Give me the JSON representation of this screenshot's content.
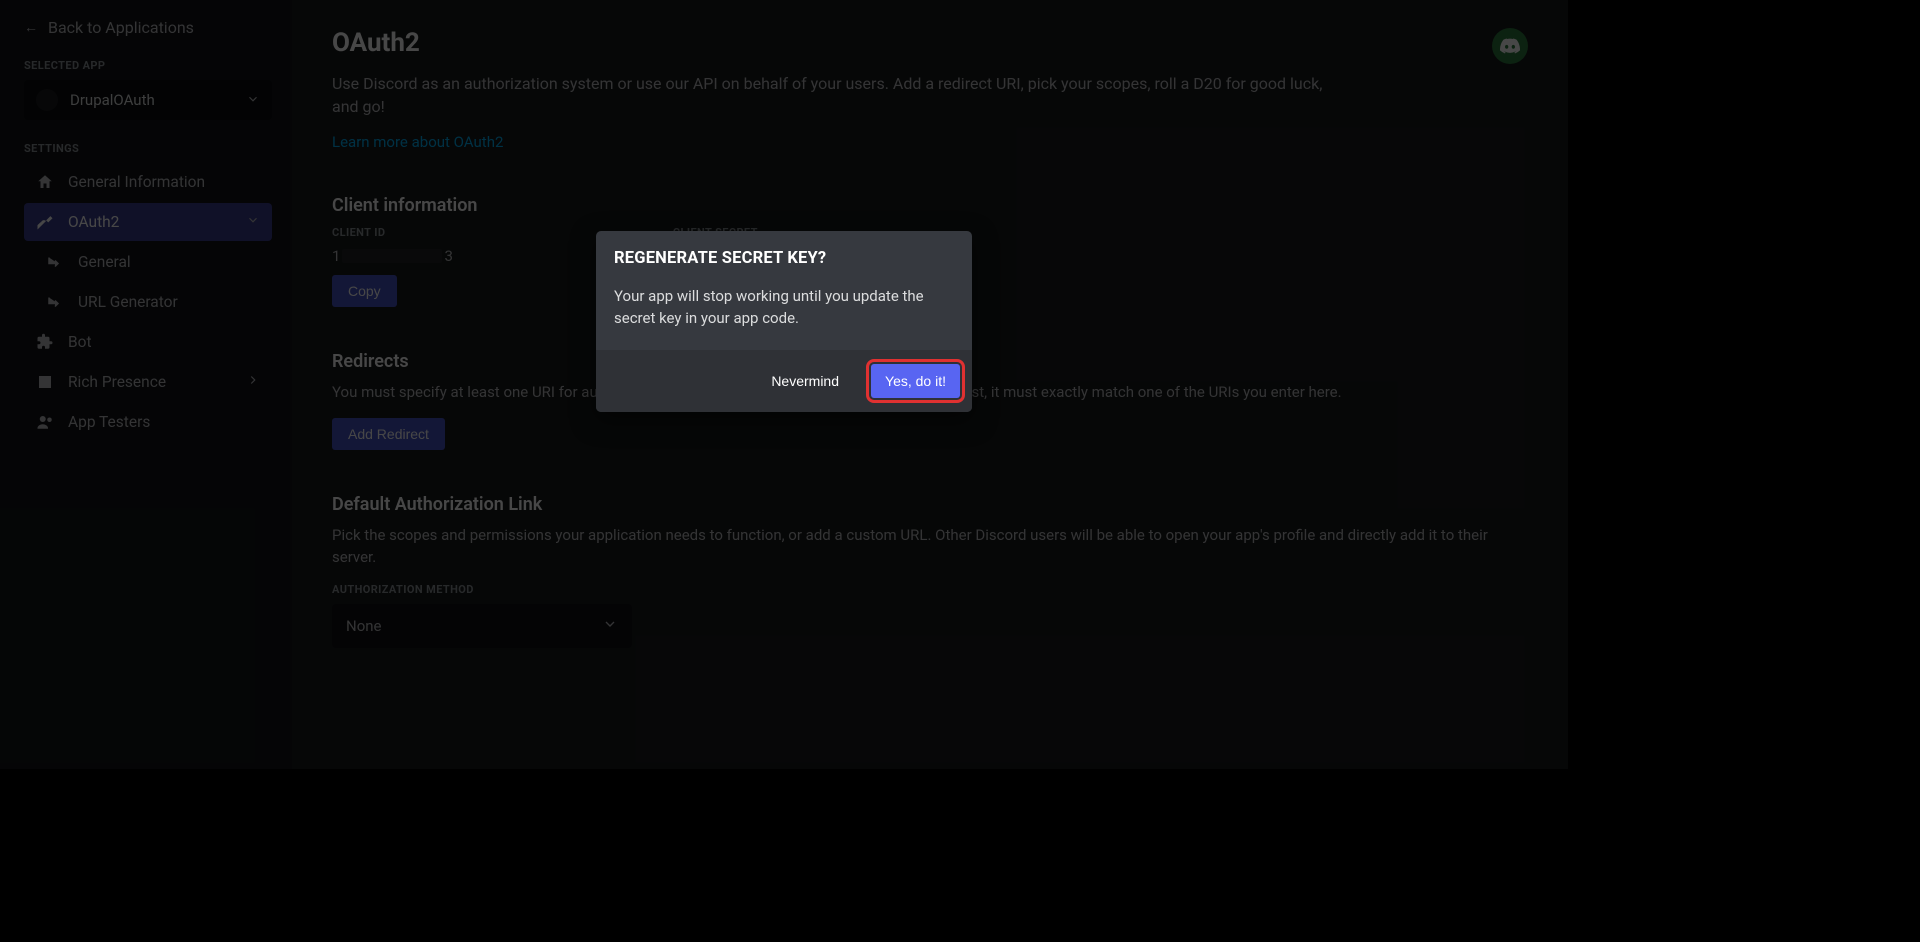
{
  "sidebar": {
    "back_label": "Back to Applications",
    "selected_app_label": "SELECTED APP",
    "app_name": "DrupalOAuth",
    "settings_label": "SETTINGS",
    "nav": {
      "general_info": "General Information",
      "oauth2": "OAuth2",
      "oauth2_general": "General",
      "oauth2_url_gen": "URL Generator",
      "bot": "Bot",
      "rich_presence": "Rich Presence",
      "app_testers": "App Testers"
    }
  },
  "page": {
    "title": "OAuth2",
    "description": "Use Discord as an authorization system or use our API on behalf of your users. Add a redirect URI, pick your scopes, roll a D20 for good luck, and go!",
    "learn_more": "Learn more about OAuth2"
  },
  "client_info": {
    "title": "Client information",
    "client_id_label": "CLIENT ID",
    "client_id_prefix": "1",
    "client_id_suffix": "3",
    "client_secret_label": "CLIENT SECRET",
    "copy_btn": "Copy"
  },
  "redirects": {
    "title": "Redirects",
    "description": "You must specify at least one URI for authentication to work. If you pass a URI in an OAuth request, it must exactly match one of the URIs you enter here.",
    "add_btn": "Add Redirect"
  },
  "auth_link": {
    "title": "Default Authorization Link",
    "description": "Pick the scopes and permissions your application needs to function, or add a custom URL. Other Discord users will be able to open your app's profile and directly add it to their server.",
    "method_label": "AUTHORIZATION METHOD",
    "method_value": "None"
  },
  "modal": {
    "title": "REGENERATE SECRET KEY?",
    "body": "Your app will stop working until you update the secret key in your app code.",
    "cancel": "Nevermind",
    "confirm": "Yes, do it!"
  }
}
